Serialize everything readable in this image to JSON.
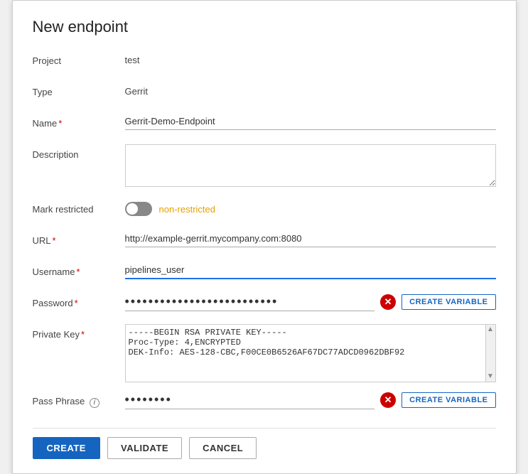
{
  "dialog": {
    "title": "New endpoint",
    "fields": {
      "project_label": "Project",
      "project_value": "test",
      "type_label": "Type",
      "type_value": "Gerrit",
      "name_label": "Name",
      "name_required": "*",
      "name_value": "Gerrit-Demo-Endpoint",
      "description_label": "Description",
      "description_value": "",
      "description_placeholder": "",
      "mark_restricted_label": "Mark restricted",
      "mark_restricted_status": "non-restricted",
      "url_label": "URL",
      "url_required": "*",
      "url_value": "http://example-gerrit.mycompany.com:8080",
      "username_label": "Username",
      "username_required": "*",
      "username_value": "pipelines_user",
      "password_label": "Password",
      "password_required": "*",
      "password_dots": "••••••••••••••••••••••••••",
      "private_key_label": "Private Key",
      "private_key_required": "*",
      "private_key_line1": "-----BEGIN RSA PRIVATE KEY-----",
      "private_key_line2": "Proc-Type: 4,ENCRYPTED",
      "private_key_line3": "DEK-Info: AES-128-CBC,F00CE0B6526AF67DC77ADCD0962DBF92",
      "pass_phrase_label": "Pass Phrase",
      "pass_phrase_info": "i",
      "pass_phrase_dots": "••••••••",
      "create_variable_label": "CREATE VARIABLE",
      "create_variable_label2": "CREATE VARIABLE"
    },
    "buttons": {
      "create": "CREATE",
      "validate": "VALIDATE",
      "cancel": "CANCEL"
    }
  }
}
